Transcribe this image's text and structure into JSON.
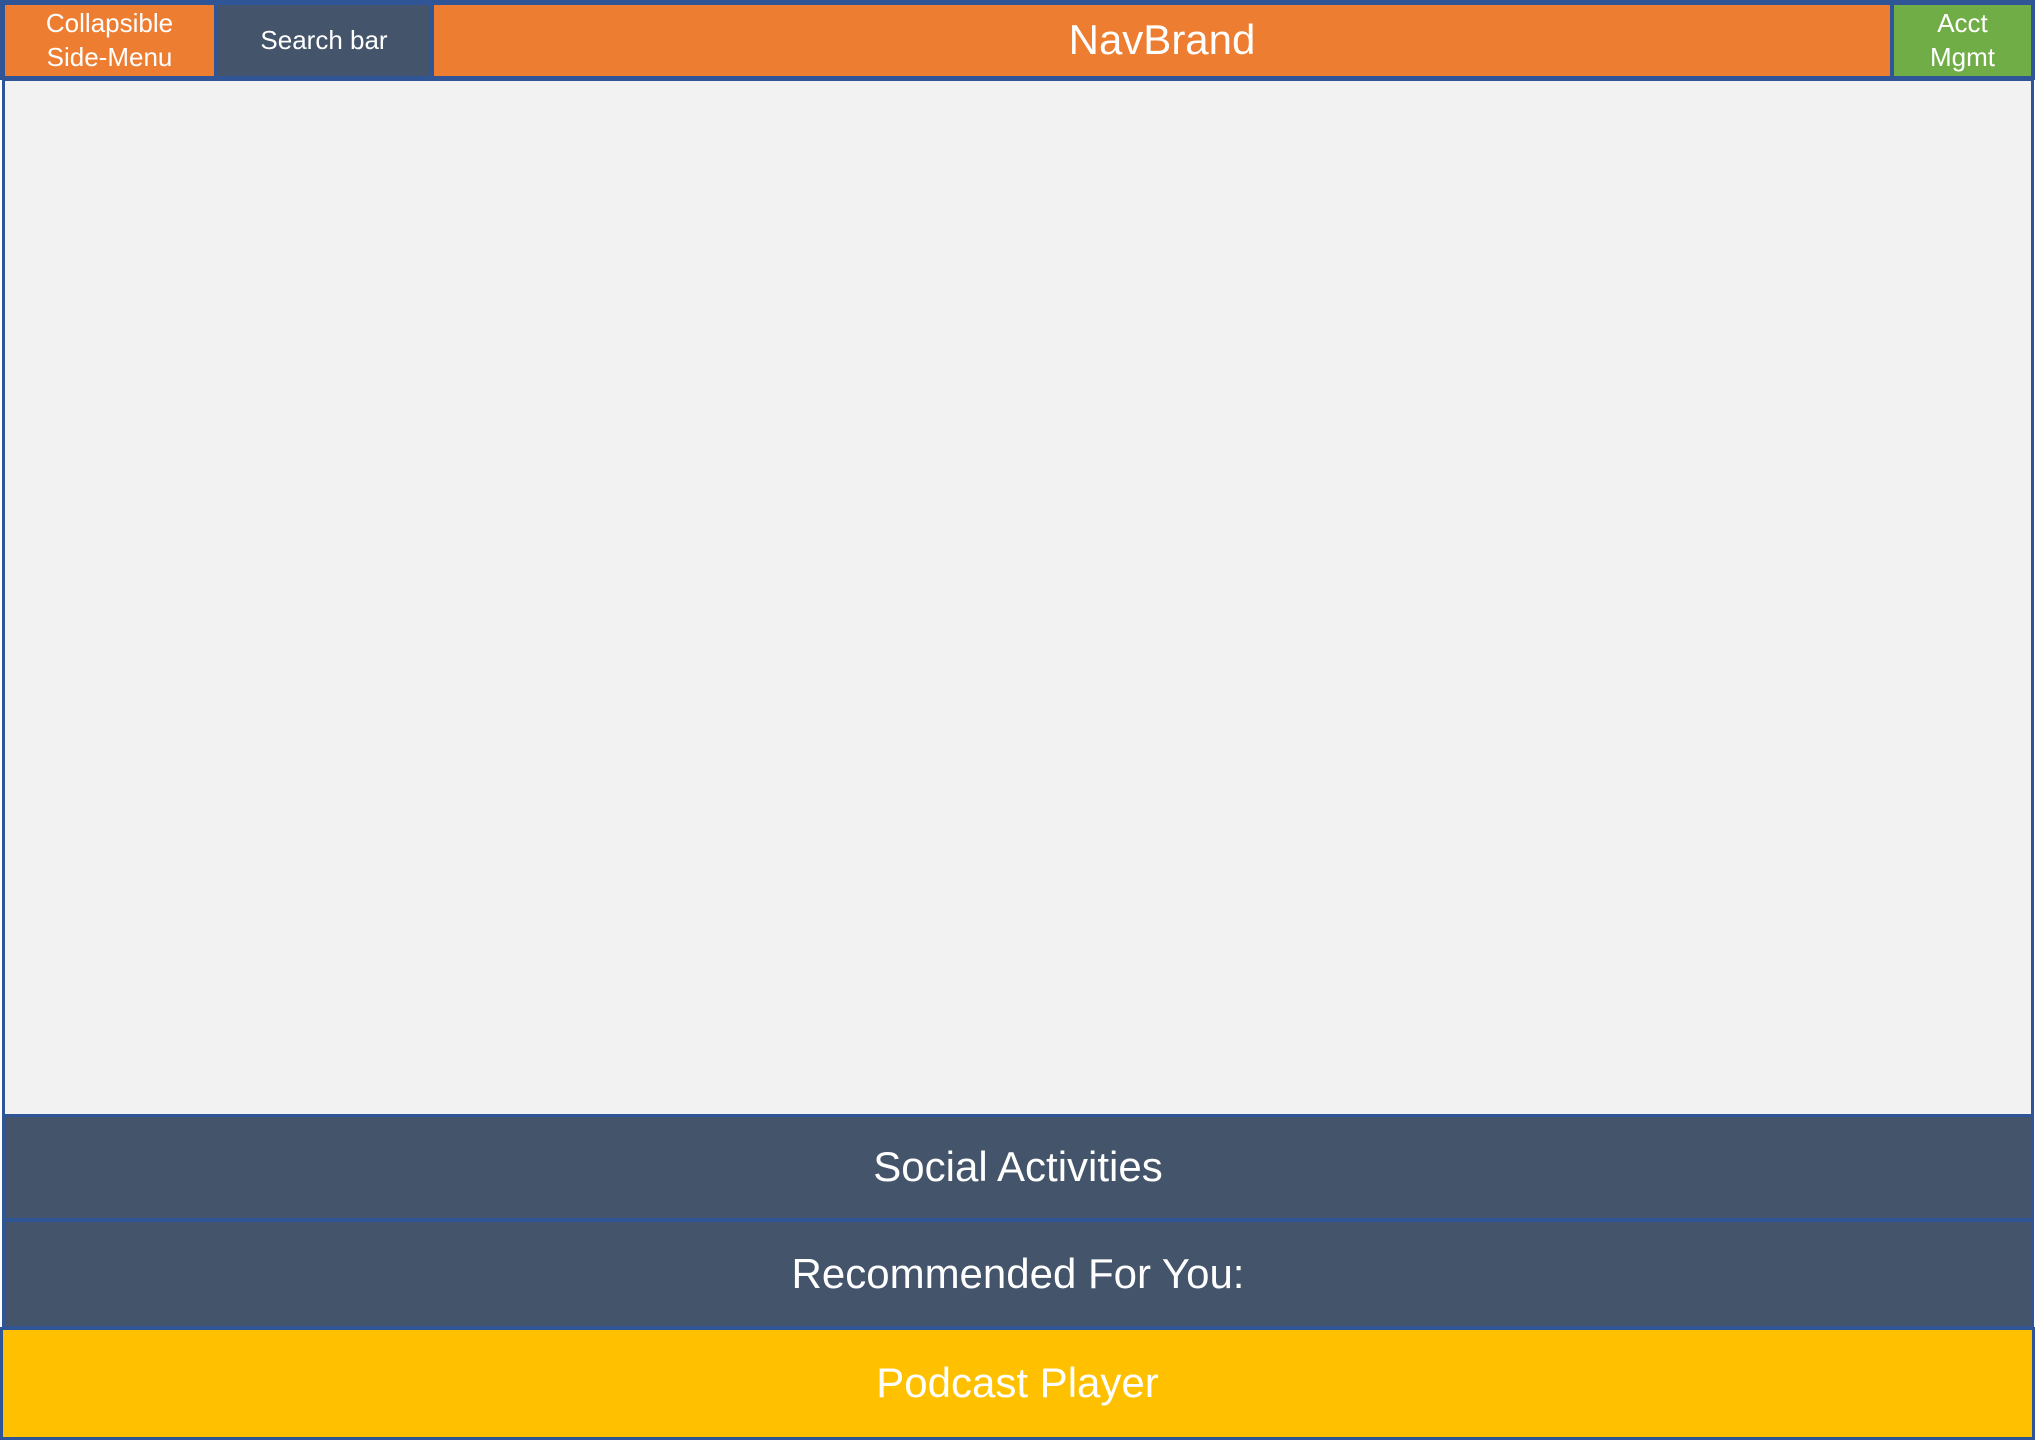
{
  "header": {
    "side_menu": {
      "label": "Collapsible\nSide-Menu",
      "color": "#ed7d31"
    },
    "search": {
      "label": "Search bar",
      "color": "#44546a"
    },
    "brand": {
      "label": "NavBrand",
      "color": "#ed7d31"
    },
    "account": {
      "label": "Acct\nMgmt",
      "color": "#70ad47"
    }
  },
  "main": {
    "color": "#f2f2f2"
  },
  "footer": {
    "social": {
      "label": "Social Activities",
      "color": "#44546a"
    },
    "recommended": {
      "label": "Recommended For You:",
      "color": "#44546a"
    },
    "player": {
      "label": "Podcast Player",
      "color": "#ffc000"
    }
  },
  "colors": {
    "border": "#2f5597",
    "text": "#ffffff"
  }
}
